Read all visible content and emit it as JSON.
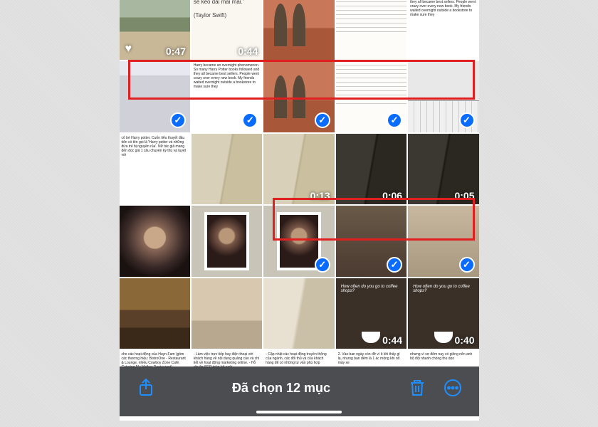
{
  "selection": {
    "title": "Đã chọn 12 mục"
  },
  "icons": {
    "share": "share-icon",
    "trash": "trash-icon",
    "more": "more-icon",
    "heart": "♥",
    "check": "✓"
  },
  "rows": [
    [
      {
        "kind": "city",
        "duration": "0:47",
        "favorite": true
      },
      {
        "kind": "quote",
        "text": "một thời bạn cho rằng nó sẽ kéo dài mãi mãi.'",
        "author": "(Taylor Swift)",
        "duration": "0:44"
      },
      {
        "kind": "church"
      },
      {
        "kind": "doc"
      },
      {
        "kind": "whitetext",
        "text": "Harry became an overnight phenomenon. So many Harry Potter books followed and they all became best sellers. People went crazy over every new book. My friends waited overnight outside a bookstore to make sure they"
      }
    ],
    [
      {
        "kind": "screen",
        "selected": true
      },
      {
        "kind": "whitetext",
        "text": "Harry became an overnight phenomenon. So many Harry Potter books followed and they all became best sellers. People went crazy over every new book. My friends waited overnight outside a bookstore to make sure they",
        "selected": true
      },
      {
        "kind": "church",
        "selected": true
      },
      {
        "kind": "doc",
        "selected": true
      },
      {
        "kind": "kb",
        "selected": true
      }
    ],
    [
      {
        "kind": "whitetext",
        "text": "cô bé Harry potter. Cuốn tiểu thuyết đầu tiên có tên gọi là 'Harry potter và những đứa trẻ bị nguyền rủa'. Nữ tác giả mang đến đọc giả 1 câu chuyện kỳ thú và tuyệt vời"
      },
      {
        "kind": "book"
      },
      {
        "kind": "book",
        "duration": "0:13"
      },
      {
        "kind": "book-dark",
        "duration": "0:06"
      },
      {
        "kind": "book-dark",
        "duration": "0:05"
      }
    ],
    [
      {
        "kind": "hands"
      },
      {
        "kind": "frame"
      },
      {
        "kind": "frame",
        "selected": true
      },
      {
        "kind": "aesthetic",
        "selected": true
      },
      {
        "kind": "aesthetic2",
        "selected": true
      }
    ],
    [
      {
        "kind": "room"
      },
      {
        "kind": "bed"
      },
      {
        "kind": "book2"
      },
      {
        "kind": "coffee",
        "question": "How often do you go to coffee shops?",
        "duration": "0:44"
      },
      {
        "kind": "coffee",
        "question": "How often do you go to coffee shops?",
        "duration": "0:40"
      }
    ],
    [
      {
        "kind": "whitetext",
        "text": "cho các hoạt động của Huyn-Fam (gồm các thương hiệu: BistroOne - Restaurant & Lounge, nhiều Cowboy Zone Café, Catering My Mother Restaurant)"
      },
      {
        "kind": "whitetext",
        "text": "- Làm việc trực tiếp hay điện thoại với khách hàng về nội dung quảng cáo và chi tiết về hoạt động marketing online.\n- Hỗ chuẩn SEO toàn bộ web"
      },
      {
        "kind": "whitetext",
        "text": "- Cập nhật các hoạt động truyền thông của ngành, các đối thủ và của khách hàng để có những tư vấn phù hợp"
      },
      {
        "kind": "whitetext",
        "text": "2. Vào ban ngày còn đỡ vì ít khi thấy gì lạ, nhưng ban đêm là 1 ác mộng khi nổ máy xe"
      },
      {
        "kind": "whitetext",
        "text": "nhưng vì sợ đêm nay có giông nên anh bộ đội nhanh chóng thu dọn"
      }
    ]
  ]
}
